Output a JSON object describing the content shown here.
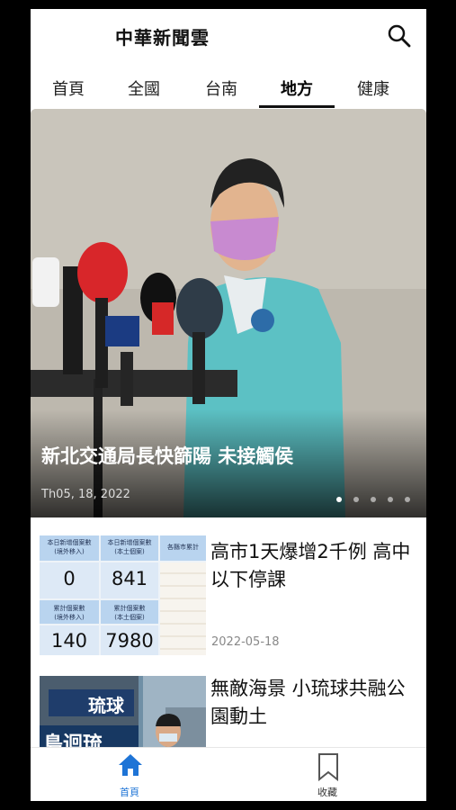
{
  "header": {
    "title": "中華新聞雲"
  },
  "tabs": [
    {
      "label": "首頁"
    },
    {
      "label": "全國"
    },
    {
      "label": "台南"
    },
    {
      "label": "地方"
    },
    {
      "label": "健康"
    }
  ],
  "active_tab": "地方",
  "hero": {
    "title": "新北交通局長快篩陽 未接觸侯",
    "date": "Th05, 18, 2022",
    "dot_count": 5,
    "active_dot": 1
  },
  "articles": [
    {
      "title": "高市1天爆增2千例 高中以下停課",
      "date": "2022-05-18",
      "thumb_text": {
        "header_left": "本日新增個案數\n(境外移入)",
        "header_mid": "本日新增個案數\n(本土個案)",
        "header_right": "各縣市累計",
        "cell_a": "0",
        "cell_b": "841",
        "row2_left": "累計個案數\n(境外移入)",
        "row2_mid": "累計個案數\n(本土個案)",
        "cell_c": "140",
        "cell_d": "7980"
      }
    },
    {
      "title": "無敵海景 小琉球共融公園動土",
      "date": "",
      "thumb_text": {
        "sign_a": "琉球",
        "sign_b": "島迴琉"
      }
    }
  ],
  "bottom_nav": [
    {
      "label": "首頁",
      "icon": "home-icon",
      "active": true
    },
    {
      "label": "收藏",
      "icon": "bookmark-icon",
      "active": false
    }
  ],
  "colors": {
    "accent": "#1e74d6",
    "text": "#111111",
    "muted": "#888888"
  }
}
